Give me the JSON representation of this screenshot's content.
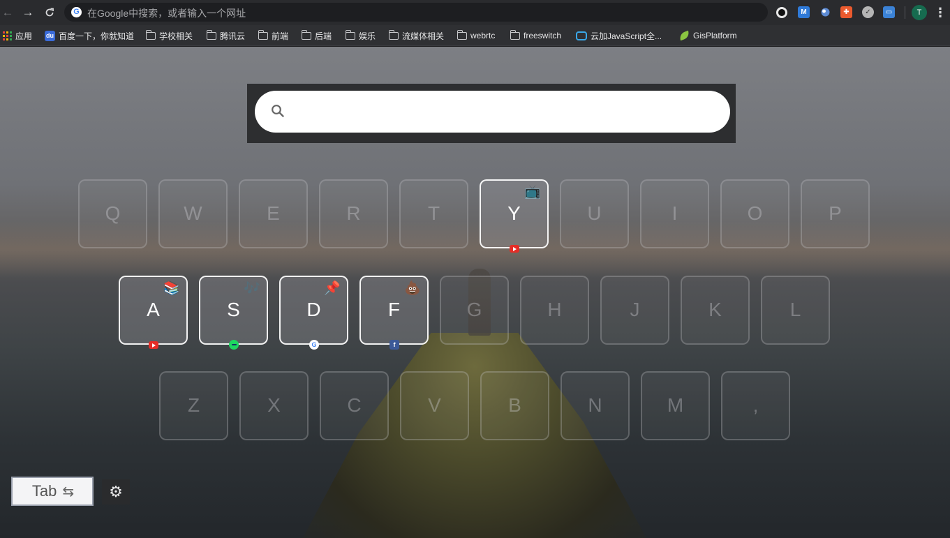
{
  "browser": {
    "address_bar": {
      "placeholder": "在Google中搜索，或者输入一个网址"
    },
    "nav": {
      "back": "←",
      "forward": "→",
      "reload": "C"
    },
    "extensions": [
      {
        "icon": "circle-extension-icon",
        "label": "●",
        "color": "#111111"
      },
      {
        "icon": "m-extension-icon",
        "label": "M",
        "color": "#2f7ad8"
      },
      {
        "icon": "globe-extension-icon",
        "label": "◐",
        "color": "#5d8bd4"
      },
      {
        "icon": "gift-extension-icon",
        "label": "✚",
        "color": "#ea5a2e"
      },
      {
        "icon": "check-extension-icon",
        "label": "✓",
        "color": "#9a9a9a"
      },
      {
        "icon": "screen-extension-icon",
        "label": "▭",
        "color": "#3b82d6"
      }
    ],
    "avatar": "T",
    "menu": "⋮"
  },
  "bookmarks": [
    {
      "label": "应用",
      "icon": "apps-grid-icon"
    },
    {
      "label": "百度一下，你就知道",
      "icon": "baidu-icon"
    },
    {
      "label": "学校相关",
      "icon": "folder-icon"
    },
    {
      "label": "腾讯云",
      "icon": "folder-icon"
    },
    {
      "label": "前端",
      "icon": "folder-icon"
    },
    {
      "label": "后端",
      "icon": "folder-icon"
    },
    {
      "label": "娱乐",
      "icon": "folder-icon"
    },
    {
      "label": "流媒体相关",
      "icon": "folder-icon"
    },
    {
      "label": "webrtc",
      "icon": "folder-icon"
    },
    {
      "label": "freeswitch",
      "icon": "folder-icon"
    },
    {
      "label": "云加JavaScript全...",
      "icon": "bilibili-icon"
    },
    {
      "label": "GisPlatform",
      "icon": "leaf-icon"
    }
  ],
  "search": {
    "placeholder": ""
  },
  "keyboard": {
    "row1": [
      "Q",
      "W",
      "E",
      "R",
      "T",
      "Y",
      "U",
      "I",
      "O",
      "P"
    ],
    "row2": [
      "A",
      "S",
      "D",
      "F",
      "G",
      "H",
      "J",
      "K",
      "L"
    ],
    "row3": [
      "Z",
      "X",
      "C",
      "V",
      "B",
      "N",
      "M",
      ","
    ],
    "bound_keys": {
      "Y": {
        "emoji": "📺",
        "site": "youtube"
      },
      "A": {
        "emoji": "📚",
        "site": "youtube"
      },
      "S": {
        "emoji": "🎶",
        "site": "spotify"
      },
      "D": {
        "emoji": "📌",
        "site": "google"
      },
      "F": {
        "emoji": "💩",
        "site": "facebook"
      }
    }
  },
  "controls": {
    "tab_label": "Tab",
    "tab_glyph": "⇆",
    "settings_glyph": "⚙"
  }
}
